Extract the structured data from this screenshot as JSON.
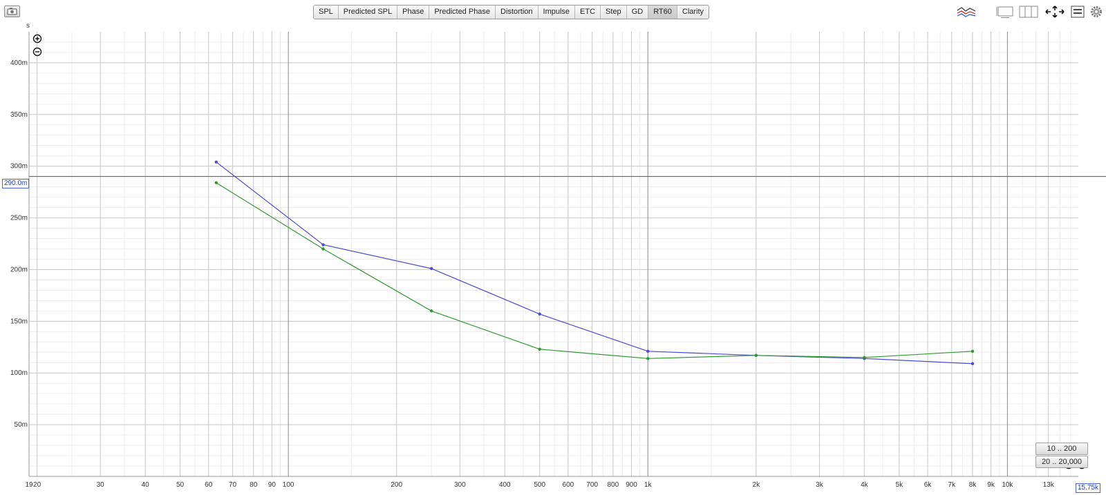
{
  "toolbar": {
    "tabs": [
      {
        "label": "SPL",
        "active": false
      },
      {
        "label": "Predicted SPL",
        "active": false
      },
      {
        "label": "Phase",
        "active": false
      },
      {
        "label": "Predicted Phase",
        "active": false
      },
      {
        "label": "Distortion",
        "active": false
      },
      {
        "label": "Impulse",
        "active": false
      },
      {
        "label": "ETC",
        "active": false
      },
      {
        "label": "Step",
        "active": false
      },
      {
        "label": "GD",
        "active": false
      },
      {
        "label": "RT60",
        "active": true
      },
      {
        "label": "Clarity",
        "active": false
      }
    ],
    "icons": [
      "camera-icon",
      "overlay-icon",
      "single-pane-icon",
      "split-pane-icon",
      "pan-arrows-icon",
      "controls-icon",
      "gear-icon"
    ]
  },
  "plot": {
    "y_unit": "s",
    "cursor_y_label": "290.0m",
    "x_readout": "15.75k",
    "range_buttons": [
      "10 .. 200",
      "20 .. 20,000"
    ],
    "zoom_icons": [
      "zoom-in-icon",
      "zoom-out-icon"
    ]
  },
  "chart_data": {
    "type": "line",
    "x_scale": "log",
    "xlim": [
      19,
      15750
    ],
    "ylim": [
      0,
      0.43
    ],
    "cursor_y": 0.29,
    "y_ticks": [
      {
        "v": 0.05,
        "label": "50m"
      },
      {
        "v": 0.1,
        "label": "100m"
      },
      {
        "v": 0.15,
        "label": "150m"
      },
      {
        "v": 0.2,
        "label": "200m"
      },
      {
        "v": 0.25,
        "label": "250m"
      },
      {
        "v": 0.3,
        "label": "300m"
      },
      {
        "v": 0.35,
        "label": "350m"
      },
      {
        "v": 0.4,
        "label": "400m"
      }
    ],
    "x_ticks": [
      {
        "v": 19,
        "label": "19"
      },
      {
        "v": 20,
        "label": "20"
      },
      {
        "v": 30,
        "label": "30"
      },
      {
        "v": 40,
        "label": "40"
      },
      {
        "v": 50,
        "label": "50"
      },
      {
        "v": 60,
        "label": "60"
      },
      {
        "v": 70,
        "label": "70"
      },
      {
        "v": 80,
        "label": "80"
      },
      {
        "v": 90,
        "label": "90"
      },
      {
        "v": 100,
        "label": "100"
      },
      {
        "v": 200,
        "label": "200"
      },
      {
        "v": 300,
        "label": "300"
      },
      {
        "v": 400,
        "label": "400"
      },
      {
        "v": 500,
        "label": "500"
      },
      {
        "v": 600,
        "label": "600"
      },
      {
        "v": 700,
        "label": "700"
      },
      {
        "v": 800,
        "label": "800"
      },
      {
        "v": 900,
        "label": "900"
      },
      {
        "v": 1000,
        "label": "1k"
      },
      {
        "v": 2000,
        "label": "2k"
      },
      {
        "v": 3000,
        "label": "3k"
      },
      {
        "v": 4000,
        "label": "4k"
      },
      {
        "v": 5000,
        "label": "5k"
      },
      {
        "v": 6000,
        "label": "6k"
      },
      {
        "v": 7000,
        "label": "7k"
      },
      {
        "v": 8000,
        "label": "8k"
      },
      {
        "v": 9000,
        "label": "9k"
      },
      {
        "v": 10000,
        "label": "10k"
      },
      {
        "v": 13000,
        "label": "13k"
      }
    ],
    "series": [
      {
        "color": "#4a4ad6",
        "x": [
          63,
          125,
          250,
          500,
          1000,
          2000,
          4000,
          8000
        ],
        "y": [
          0.304,
          0.224,
          0.201,
          0.157,
          0.121,
          0.117,
          0.114,
          0.109
        ]
      },
      {
        "color": "#2f9a2f",
        "x": [
          63,
          125,
          250,
          500,
          1000,
          2000,
          4000,
          8000
        ],
        "y": [
          0.284,
          0.22,
          0.16,
          0.123,
          0.114,
          0.117,
          0.115,
          0.121
        ]
      }
    ]
  }
}
